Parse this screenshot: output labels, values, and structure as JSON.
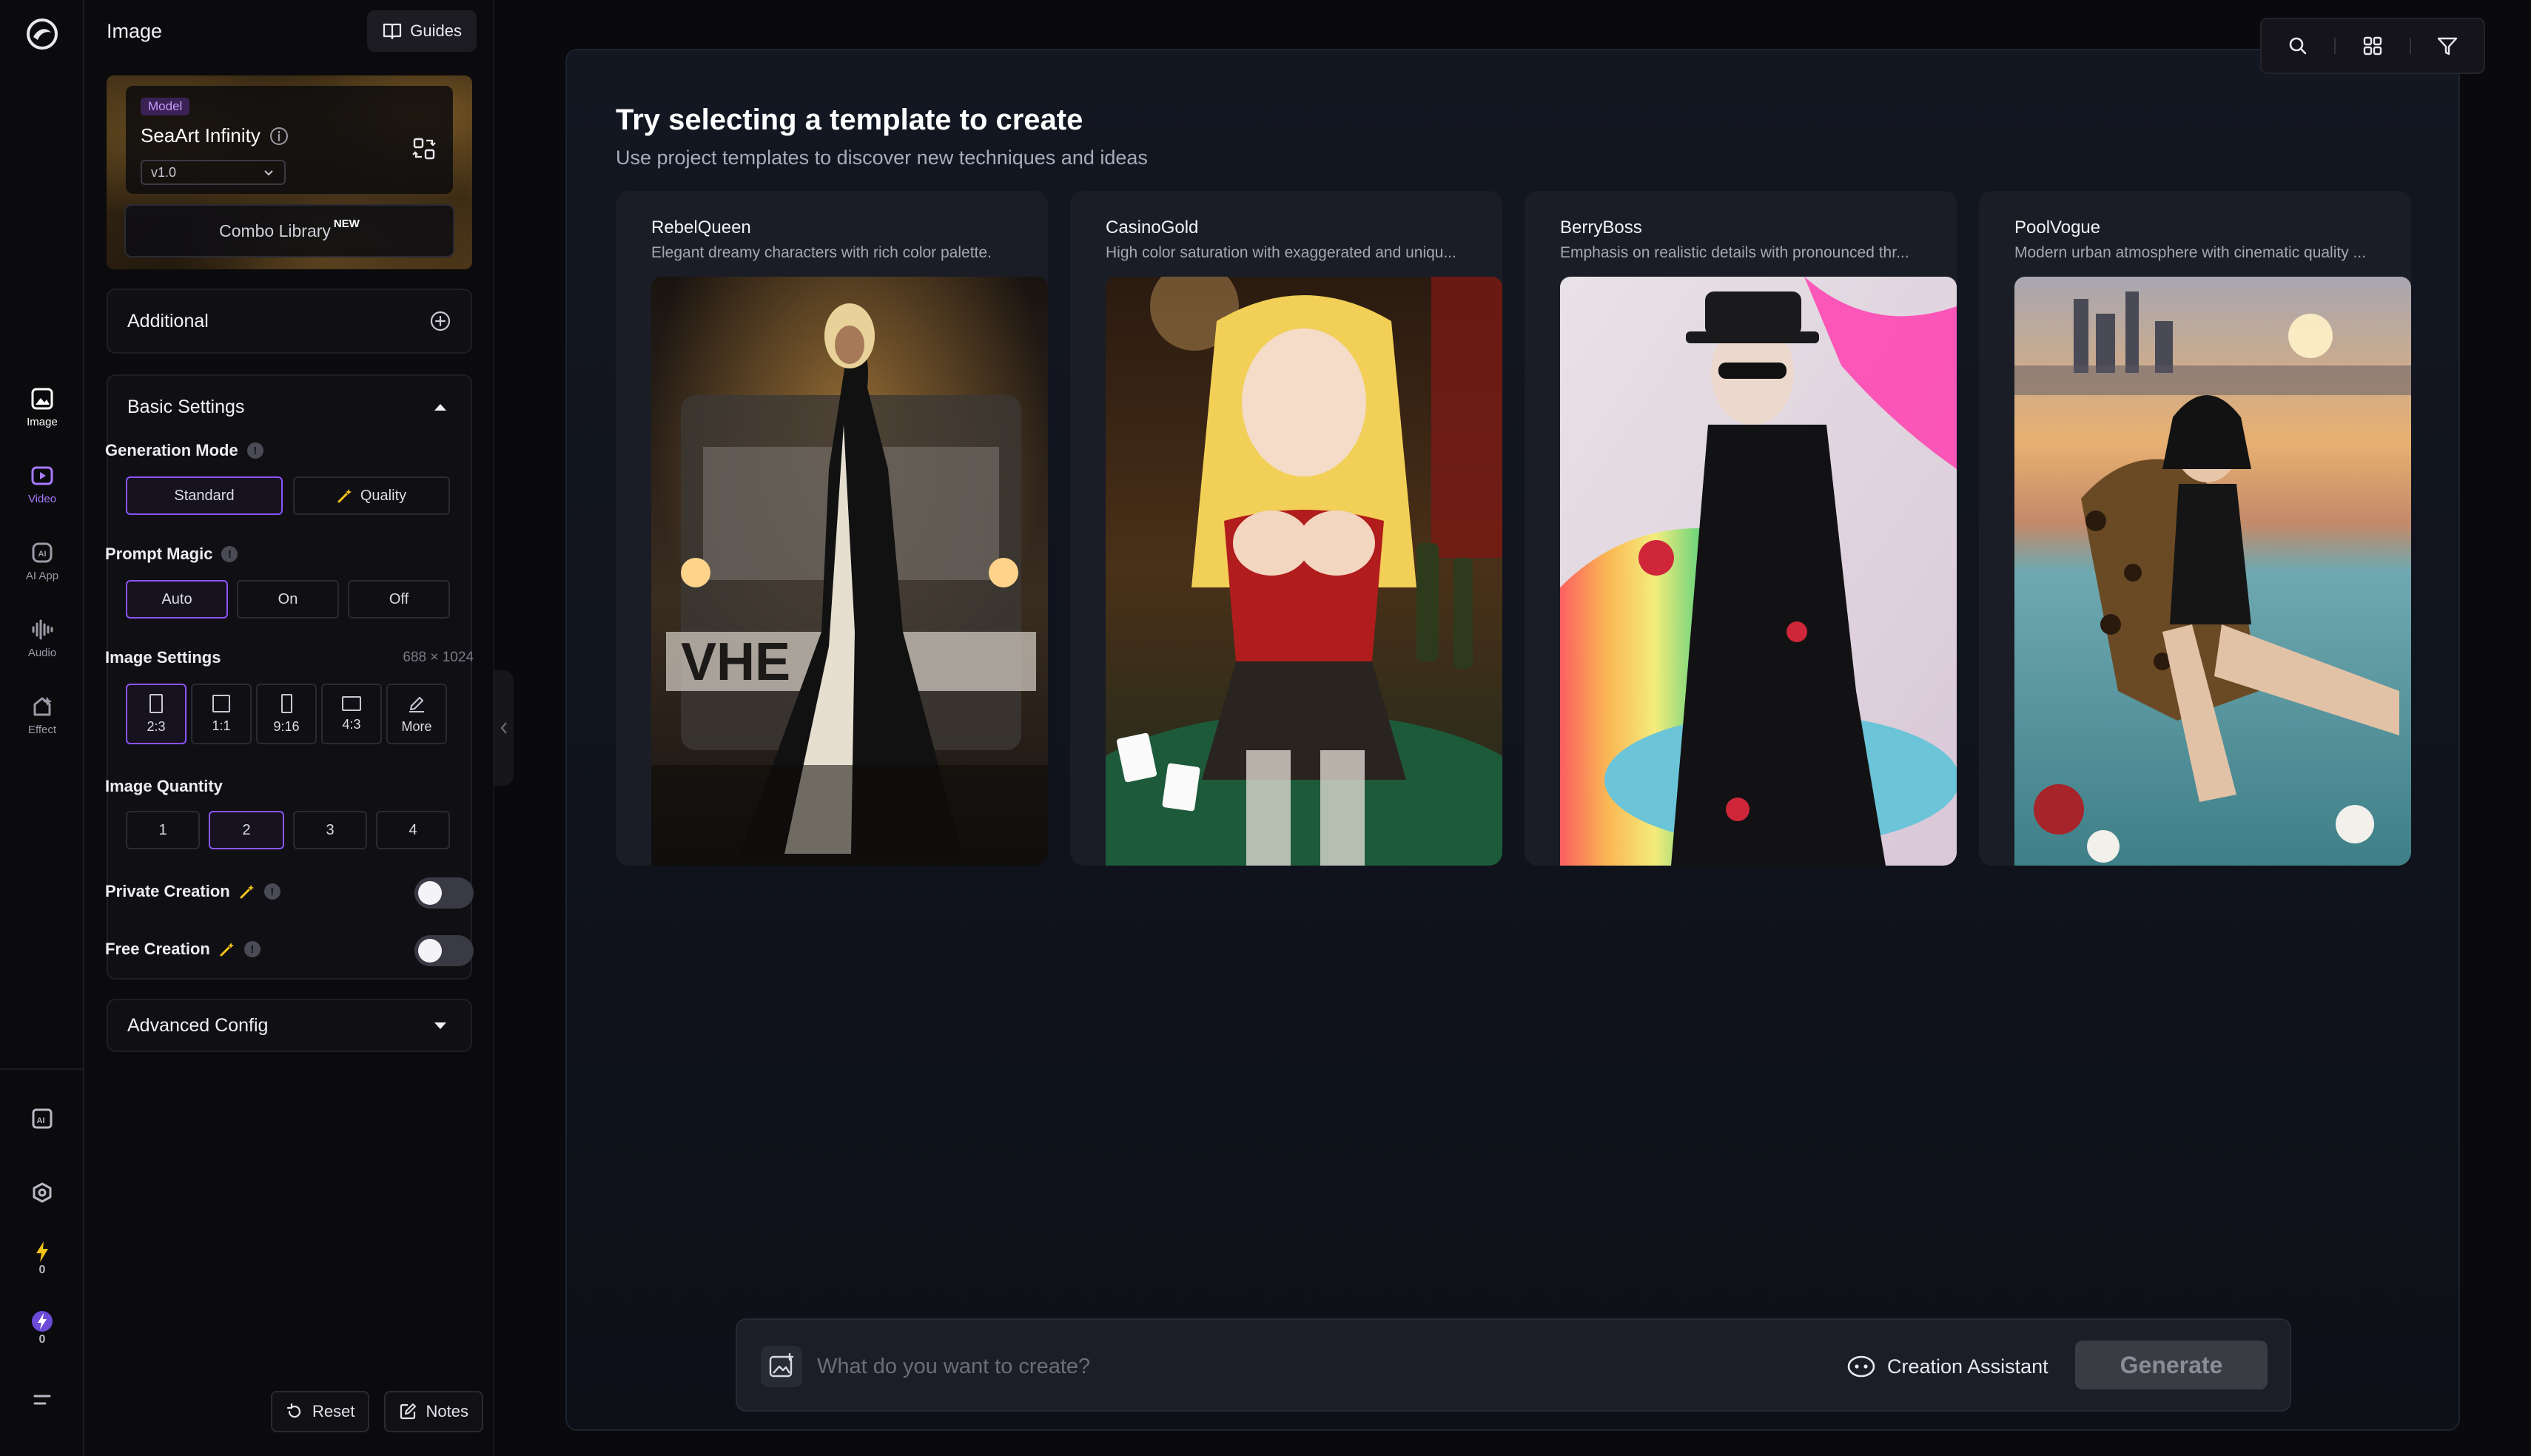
{
  "rail": {
    "items": [
      {
        "label": "Image",
        "icon": "image-icon"
      },
      {
        "label": "Video",
        "icon": "video-icon"
      },
      {
        "label": "AI App",
        "icon": "ai-app-icon"
      },
      {
        "label": "Audio",
        "icon": "audio-icon"
      },
      {
        "label": "Effect",
        "icon": "effect-icon"
      }
    ],
    "credits_1": "0",
    "credits_2": "0"
  },
  "panel": {
    "title": "Image",
    "guides_label": "Guides",
    "model": {
      "tag": "Model",
      "name": "SeaArt Infinity",
      "version": "v1.0",
      "combo_label": "Combo Library",
      "combo_badge": "NEW"
    },
    "additional_label": "Additional",
    "basic_settings_label": "Basic Settings",
    "generation_mode": {
      "label": "Generation Mode",
      "options": [
        "Standard",
        "Quality"
      ],
      "selected": "Standard"
    },
    "prompt_magic": {
      "label": "Prompt Magic",
      "options": [
        "Auto",
        "On",
        "Off"
      ],
      "selected": "Auto"
    },
    "image_settings": {
      "label": "Image Settings",
      "size": "688 × 1024",
      "ratios": [
        "2:3",
        "1:1",
        "9:16",
        "4:3",
        "More"
      ],
      "selected": "2:3"
    },
    "image_quantity": {
      "label": "Image Quantity",
      "options": [
        "1",
        "2",
        "3",
        "4"
      ],
      "selected": "2"
    },
    "private_creation": {
      "label": "Private Creation",
      "enabled": false
    },
    "free_creation": {
      "label": "Free Creation",
      "enabled": false
    },
    "advanced_config_label": "Advanced Config",
    "reset_label": "Reset",
    "notes_label": "Notes"
  },
  "main": {
    "title": "Try selecting a template to create",
    "subtitle": "Use project templates to discover new techniques and ideas",
    "templates": [
      {
        "name": "RebelQueen",
        "desc": "Elegant dreamy characters with rich color palette."
      },
      {
        "name": "CasinoGold",
        "desc": "High color saturation with exaggerated and uniqu..."
      },
      {
        "name": "BerryBoss",
        "desc": "Emphasis on realistic details with pronounced thr..."
      },
      {
        "name": "PoolVogue",
        "desc": "Modern urban atmosphere with cinematic quality ..."
      }
    ],
    "prompt": {
      "placeholder": "What do you want to create?",
      "assistant_label": "Creation Assistant",
      "generate_label": "Generate"
    }
  },
  "colors": {
    "accent": "#8a55ff",
    "video_accent": "#a87bff",
    "background": "#0a0a0c"
  }
}
